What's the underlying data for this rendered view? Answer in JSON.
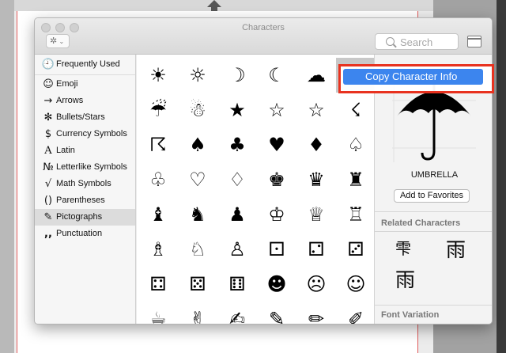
{
  "window": {
    "title": "Characters"
  },
  "toolbar": {
    "search_placeholder": "Search"
  },
  "sidebar": {
    "items": [
      {
        "icon": "🕘",
        "label": "Frequently Used"
      },
      {
        "icon": "☺",
        "label": "Emoji"
      },
      {
        "icon": "→",
        "label": "Arrows"
      },
      {
        "icon": "✻",
        "label": "Bullets/Stars"
      },
      {
        "icon": "$",
        "label": "Currency Symbols"
      },
      {
        "icon": "A",
        "label": "Latin"
      },
      {
        "icon": "№",
        "label": "Letterlike Symbols"
      },
      {
        "icon": "√",
        "label": "Math Symbols"
      },
      {
        "icon": "()",
        "label": "Parentheses"
      },
      {
        "icon": "✎",
        "label": "Pictographs"
      },
      {
        "icon": ",,",
        "label": "Punctuation"
      }
    ],
    "selected": "Pictographs"
  },
  "grid": {
    "rows": [
      [
        "☀",
        "☼",
        "☽",
        "☾",
        "☁",
        "☂"
      ],
      [
        "☔",
        "☃",
        "★",
        "☆",
        "☆",
        "☇"
      ],
      [
        "☈",
        "♠",
        "♣",
        "♥",
        "♦",
        "♤"
      ],
      [
        "♧",
        "♡",
        "♢",
        "♚",
        "♛",
        "♜"
      ],
      [
        "♝",
        "♞",
        "♟",
        "♔",
        "♕",
        "♖"
      ],
      [
        "♗",
        "♘",
        "♙",
        "⚀",
        "⚁",
        "⚂"
      ],
      [
        "⚃",
        "⚄",
        "⚅",
        "☻",
        "☹",
        "☺"
      ],
      [
        "☕",
        "✌",
        "✍",
        "✎",
        "✏",
        "✐"
      ]
    ],
    "selected_char": "☂"
  },
  "detail": {
    "character_name": "UMBRELLA",
    "add_favorites": "Add to Favorites",
    "related_title": "Related Characters",
    "related_chars": [
      "雫",
      "雨",
      "雨"
    ],
    "font_variation_title": "Font Variation"
  },
  "context_menu": {
    "item": "Copy Character Info"
  },
  "colors": {
    "menu_highlight": "#3c85ee",
    "annotation_outline": "#e8321f"
  }
}
